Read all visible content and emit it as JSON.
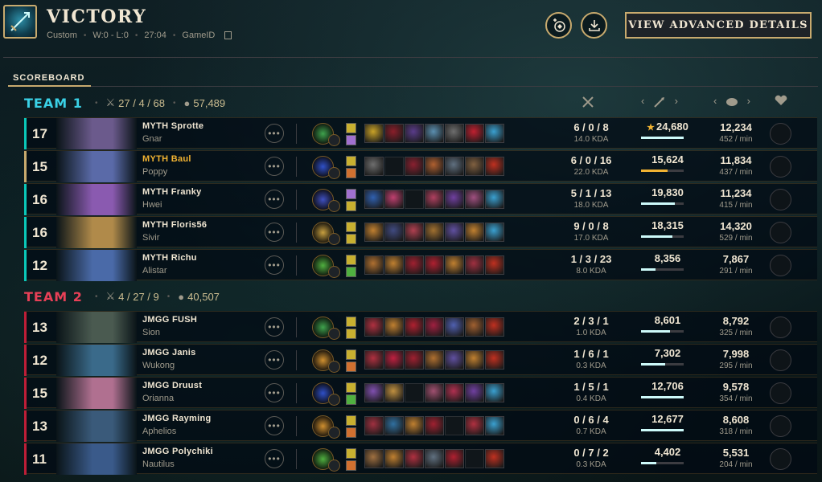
{
  "header": {
    "title": "VICTORY",
    "queue": "Custom",
    "record": "W:0 - L:0",
    "duration": "27:04",
    "game_id_label": "GameID",
    "advanced_button": "VIEW ADVANCED DETAILS"
  },
  "section_label": "SCOREBOARD",
  "columns": {
    "damage_arrows": "‹  ›",
    "gold_arrows": "‹  ›"
  },
  "teams": [
    {
      "name": "TEAM 1",
      "kda": "27 / 4 / 68",
      "gold": "57,489",
      "color": "#3ad1e6",
      "players": [
        {
          "level": "17",
          "name": "MYTH Sprotte",
          "champion": "Gnar",
          "kda": "6 / 0 / 8",
          "kda_ratio": "14.0 KDA",
          "damage": "24,680",
          "damage_share": 1.0,
          "top": true,
          "gold": "12,234",
          "gpm": "452 / min",
          "portrait": "#6b5a8c",
          "rune": "#3fa34d",
          "items": [
            "#c9a227",
            "#8a1e2a",
            "#5a3c8a",
            "#5b8fb0",
            "#6e6e6e",
            "#c02030",
            "#3aa0d0"
          ],
          "spells": [
            "#c8b030",
            "#a070d0"
          ]
        },
        {
          "level": "15",
          "name": "MYTH Baul",
          "champion": "Poppy",
          "kda": "6 / 0 / 16",
          "kda_ratio": "22.0 KDA",
          "damage": "15,624",
          "damage_share": 0.63,
          "top": false,
          "me": true,
          "gold": "11,834",
          "gpm": "437 / min",
          "portrait": "#5a6aa8",
          "rune": "#3050c8",
          "items": [
            "#6e6e6e",
            "empty",
            "#8a2030",
            "#b06030",
            "#607080",
            "#806040",
            "#c03020"
          ],
          "spells": [
            "#c8b030",
            "#d07030"
          ]
        },
        {
          "level": "16",
          "name": "MYTH Franky",
          "champion": "Hwei",
          "kda": "5 / 1 / 13",
          "kda_ratio": "18.0 KDA",
          "damage": "19,830",
          "damage_share": 0.8,
          "top": false,
          "gold": "11,234",
          "gpm": "415 / min",
          "portrait": "#8a5ab0",
          "rune": "#4050c0",
          "items": [
            "#3060b0",
            "#c04070",
            "empty",
            "#b04060",
            "#7040a0",
            "#a05080",
            "#3aa0d0"
          ],
          "spells": [
            "#a070d0",
            "#c8b030"
          ]
        },
        {
          "level": "16",
          "name": "MYTH Floris56",
          "champion": "Sivir",
          "kda": "9 / 0 / 8",
          "kda_ratio": "17.0 KDA",
          "damage": "18,315",
          "damage_share": 0.74,
          "top": false,
          "gold": "14,320",
          "gpm": "529 / min",
          "portrait": "#b08a4a",
          "rune": "#c8a040",
          "items": [
            "#c08030",
            "#404a80",
            "#b04050",
            "#a07030",
            "#6050a0",
            "#c08030",
            "#3aa0d0"
          ],
          "spells": [
            "#c8b030",
            "#c8b030"
          ]
        },
        {
          "level": "12",
          "name": "MYTH Richu",
          "champion": "Alistar",
          "kda": "1 / 3 / 23",
          "kda_ratio": "8.0 KDA",
          "damage": "8,356",
          "damage_share": 0.34,
          "top": false,
          "gold": "7,867",
          "gpm": "291 / min",
          "portrait": "#4a6aa8",
          "rune": "#50b040",
          "items": [
            "#b07030",
            "#c08030",
            "#a02030",
            "#b02030",
            "#c08030",
            "#a03040",
            "#c03020"
          ],
          "spells": [
            "#c8b030",
            "#50b040"
          ]
        }
      ]
    },
    {
      "name": "TEAM 2",
      "kda": "4 / 27 / 9",
      "gold": "40,507",
      "color": "#e84057",
      "players": [
        {
          "level": "13",
          "name": "JMGG FUSH",
          "champion": "Sion",
          "kda": "2 / 3 / 1",
          "kda_ratio": "1.0 KDA",
          "damage": "8,601",
          "damage_share": 0.68,
          "top": false,
          "gold": "8,792",
          "gpm": "325 / min",
          "portrait": "#4a5a50",
          "rune": "#3fa34d",
          "items": [
            "#b03040",
            "#c08030",
            "#b02030",
            "#a02040",
            "#5060b0",
            "#a06030",
            "#c03020"
          ],
          "spells": [
            "#c8b030",
            "#c8b030"
          ]
        },
        {
          "level": "12",
          "name": "JMGG Janis",
          "champion": "Wukong",
          "kda": "1 / 6 / 1",
          "kda_ratio": "0.3 KDA",
          "damage": "7,302",
          "damage_share": 0.57,
          "top": false,
          "gold": "7,998",
          "gpm": "295 / min",
          "portrait": "#3a6a8a",
          "rune": "#d09030",
          "items": [
            "#b03040",
            "#c02040",
            "#a02030",
            "#b07030",
            "#6050a0",
            "#c08030",
            "#c03020"
          ],
          "spells": [
            "#c8b030",
            "#d07030"
          ]
        },
        {
          "level": "15",
          "name": "JMGG Druust",
          "champion": "Orianna",
          "kda": "1 / 5 / 1",
          "kda_ratio": "0.4 KDA",
          "damage": "12,706",
          "damage_share": 1.0,
          "top": false,
          "gold": "9,578",
          "gpm": "354 / min",
          "portrait": "#b07090",
          "rune": "#3050c8",
          "items": [
            "#8050b0",
            "#c09040",
            "empty",
            "#a05070",
            "#b03050",
            "#7040a0",
            "#3aa0d0"
          ],
          "spells": [
            "#c8b030",
            "#50b040"
          ]
        },
        {
          "level": "13",
          "name": "JMGG Rayming",
          "champion": "Aphelios",
          "kda": "0 / 6 / 4",
          "kda_ratio": "0.7 KDA",
          "damage": "12,677",
          "damage_share": 1.0,
          "top": false,
          "gold": "8,608",
          "gpm": "318 / min",
          "portrait": "#3a5a7a",
          "rune": "#d09030",
          "items": [
            "#a03040",
            "#3070a0",
            "#c08030",
            "#a02030",
            "empty",
            "#b03040",
            "#3aa0d0"
          ],
          "spells": [
            "#c8b030",
            "#d07030"
          ]
        },
        {
          "level": "11",
          "name": "JMGG Polychiki",
          "champion": "Nautilus",
          "kda": "0 / 7 / 2",
          "kda_ratio": "0.3 KDA",
          "damage": "4,402",
          "damage_share": 0.35,
          "top": false,
          "gold": "5,531",
          "gpm": "204 / min",
          "portrait": "#3a5a8a",
          "rune": "#50b040",
          "items": [
            "#a07040",
            "#c08030",
            "#b03040",
            "#607080",
            "#b02030",
            "empty",
            "#c03020"
          ],
          "spells": [
            "#c8b030",
            "#d07030"
          ]
        }
      ]
    }
  ]
}
